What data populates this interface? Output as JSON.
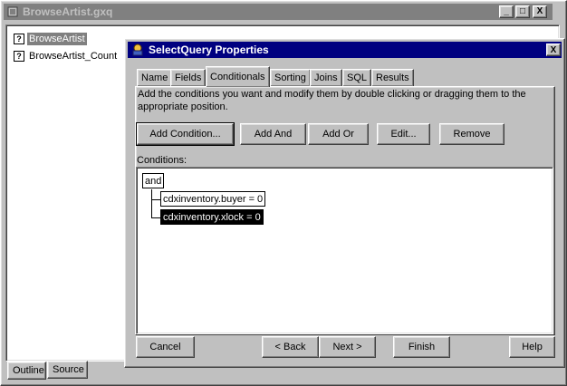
{
  "outer_window": {
    "title": "BrowseArtist.gxq",
    "controls": {
      "minimize": "_",
      "maximize": "□",
      "close": "X"
    }
  },
  "outline": {
    "items": [
      {
        "label": "BrowseArtist",
        "selected": true
      },
      {
        "label": "BrowseArtist_Count",
        "selected": false
      }
    ],
    "bottom_tabs": [
      "Outline",
      "Source"
    ]
  },
  "dialog": {
    "title": "SelectQuery Properties",
    "close": "X",
    "tabs": [
      "Name",
      "Fields",
      "Conditionals",
      "Sorting",
      "Joins",
      "SQL",
      "Results"
    ],
    "active_tab": "Conditionals",
    "description": "Add the conditions you want and modify them by double clicking or dragging them to the appropriate position.",
    "buttons": {
      "add_condition": "Add Condition...",
      "add_and": "Add And",
      "add_or": "Add Or",
      "edit": "Edit...",
      "remove": "Remove"
    },
    "conditions_label": "Conditions:",
    "conditions": {
      "root": "and",
      "children": [
        "cdxinventory.buyer = 0",
        "cdxinventory.xlock = 0"
      ],
      "selected_child": 1
    },
    "footer": {
      "cancel": "Cancel",
      "back": "< Back",
      "next": "Next >",
      "finish": "Finish",
      "help": "Help"
    }
  },
  "colors": {
    "active_title": "#000080",
    "inactive_title": "#808080",
    "face": "#c0c0c0"
  }
}
